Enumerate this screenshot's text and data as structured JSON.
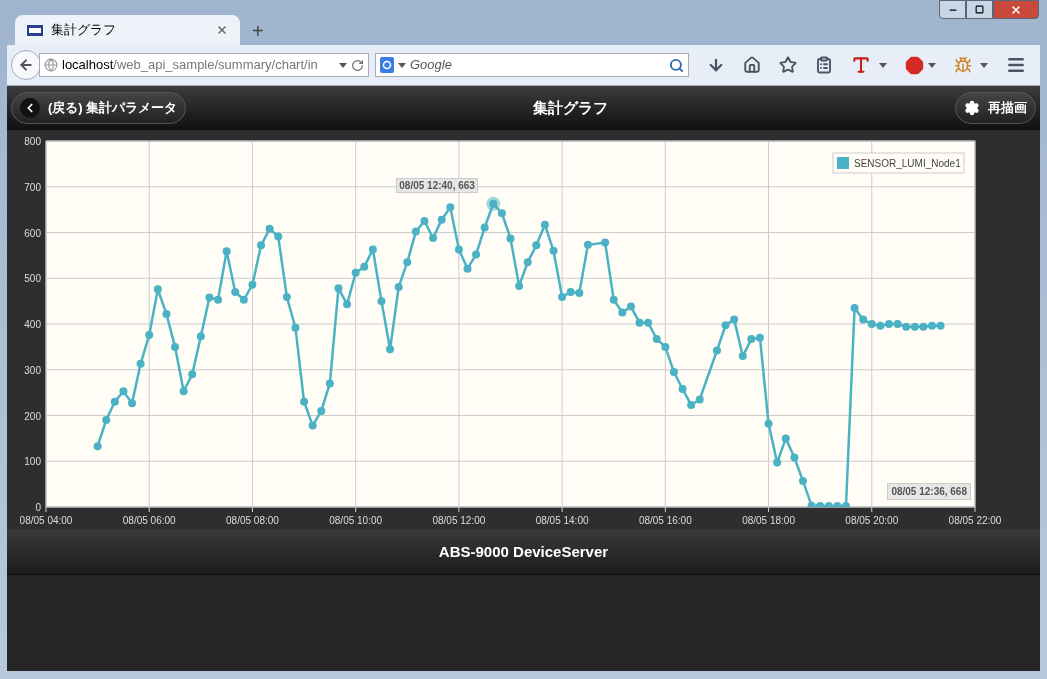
{
  "browser": {
    "tab": {
      "title": "集計グラフ",
      "selected": true
    },
    "new_tab": "+",
    "address": {
      "host": "localhost",
      "path": "/web_api_sample/summary/chart/in"
    },
    "search": {
      "placeholder": "Google"
    }
  },
  "header": {
    "back_button": "(戻る) 集計パラメータ",
    "title": "集計グラフ",
    "redraw_button": "再描画"
  },
  "chart": {
    "readout": "08/05 12:36, 668",
    "chart_data": {
      "type": "line",
      "grid": true,
      "ylim": [
        0,
        800
      ],
      "categories": [
        "08/05 04:00",
        null,
        null,
        null,
        null,
        null,
        null,
        null,
        null,
        null,
        null,
        null,
        "08/05 06:00",
        null,
        null,
        null,
        null,
        null,
        null,
        null,
        null,
        null,
        null,
        null,
        "08/05 08:00",
        null,
        null,
        null,
        null,
        null,
        null,
        null,
        null,
        null,
        null,
        null,
        "08/05 10:00",
        null,
        null,
        null,
        null,
        null,
        null,
        null,
        null,
        null,
        null,
        null,
        "08/05 12:00",
        null,
        null,
        null,
        null,
        null,
        null,
        null,
        null,
        null,
        null,
        null,
        "08/05 14:00",
        null,
        null,
        null,
        null,
        null,
        null,
        null,
        null,
        null,
        null,
        null,
        "08/05 16:00",
        null,
        null,
        null,
        null,
        null,
        null,
        null,
        null,
        null,
        null,
        null,
        "08/05 18:00",
        null,
        null,
        null,
        null,
        null,
        null,
        null,
        null,
        null,
        null,
        null,
        "08/05 20:00",
        null,
        null,
        null,
        null,
        null,
        null,
        null,
        null,
        null,
        null,
        null,
        "08/05 22:00"
      ],
      "yticks": [
        0,
        100,
        200,
        300,
        400,
        500,
        600,
        700,
        800
      ],
      "series": [
        {
          "name": "SENSOR_LUMI_Node1",
          "color": "#4bb2c5",
          "marker": "circle",
          "values": [
            null,
            null,
            null,
            null,
            null,
            null,
            133,
            190,
            230,
            253,
            227,
            313,
            376,
            476,
            422,
            350,
            253,
            290,
            373,
            458,
            453,
            559,
            470,
            453,
            486,
            572,
            608,
            591,
            459,
            392,
            230,
            178,
            210,
            270,
            478,
            443,
            512,
            525,
            563,
            450,
            345,
            481,
            535,
            602,
            625,
            588,
            628,
            655,
            563,
            521,
            552,
            611,
            663,
            642,
            587,
            483,
            535,
            572,
            617,
            560,
            459,
            470,
            468,
            573,
            null,
            578,
            453,
            425,
            438,
            403,
            403,
            367,
            350,
            295,
            258,
            223,
            235,
            null,
            342,
            397,
            410,
            330,
            367,
            370,
            182,
            97,
            150,
            108,
            57,
            3,
            2,
            2,
            2,
            2,
            435,
            410,
            400,
            396,
            400,
            400,
            394,
            394,
            394,
            396,
            396,
            null,
            null,
            null,
            null
          ]
        }
      ],
      "annotations": [
        "08/05 12:40, 663"
      ]
    }
  },
  "footer": {
    "title": "ABS-9000 DeviceServer"
  }
}
